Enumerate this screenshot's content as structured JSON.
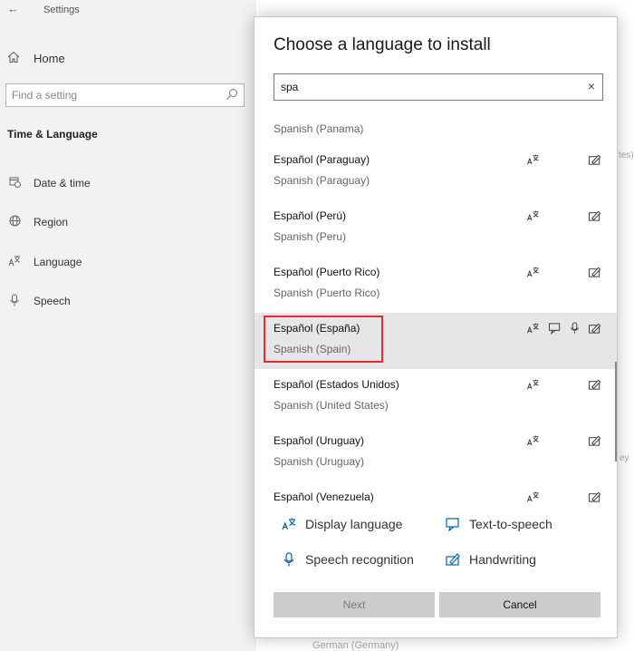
{
  "settings": {
    "window_title": "Settings",
    "home_label": "Home",
    "find_placeholder": "Find a setting",
    "section_title": "Time & Language",
    "nav": [
      {
        "label": "Date & time"
      },
      {
        "label": "Region"
      },
      {
        "label": "Language"
      },
      {
        "label": "Speech"
      }
    ],
    "peek_texts": [
      "tes)",
      "ey",
      "German (Germany)"
    ]
  },
  "dialog": {
    "title": "Choose a language to install",
    "search_value": "spa",
    "clear_label": "×",
    "partial_english": "Spanish (Panama)",
    "rows": [
      {
        "native": "Español (Paraguay)",
        "english": "Spanish (Paraguay)",
        "features": [
          "display-language",
          "handwriting"
        ]
      },
      {
        "native": "Español (Perú)",
        "english": "Spanish (Peru)",
        "features": [
          "display-language",
          "handwriting"
        ]
      },
      {
        "native": "Español (Puerto Rico)",
        "english": "Spanish (Puerto Rico)",
        "features": [
          "display-language",
          "handwriting"
        ]
      },
      {
        "native": "Español (España)",
        "english": "Spanish (Spain)",
        "features": [
          "display-language",
          "text-to-speech",
          "speech-recognition",
          "handwriting"
        ],
        "selected": true
      },
      {
        "native": "Español (Estados Unidos)",
        "english": "Spanish (United States)",
        "features": [
          "display-language",
          "handwriting"
        ]
      },
      {
        "native": "Español (Uruguay)",
        "english": "Spanish (Uruguay)",
        "features": [
          "display-language",
          "handwriting"
        ]
      },
      {
        "native": "Español (Venezuela)",
        "english": "",
        "features": [
          "display-language",
          "handwriting"
        ]
      }
    ],
    "legend": {
      "display_language": "Display language",
      "text_to_speech": "Text-to-speech",
      "speech_recognition": "Speech recognition",
      "handwriting": "Handwriting"
    },
    "buttons": {
      "next": "Next",
      "cancel": "Cancel"
    },
    "colors": {
      "accent": "#0063b1",
      "highlight": "#e22d2d",
      "selected_row": "#e6e6e6"
    }
  }
}
